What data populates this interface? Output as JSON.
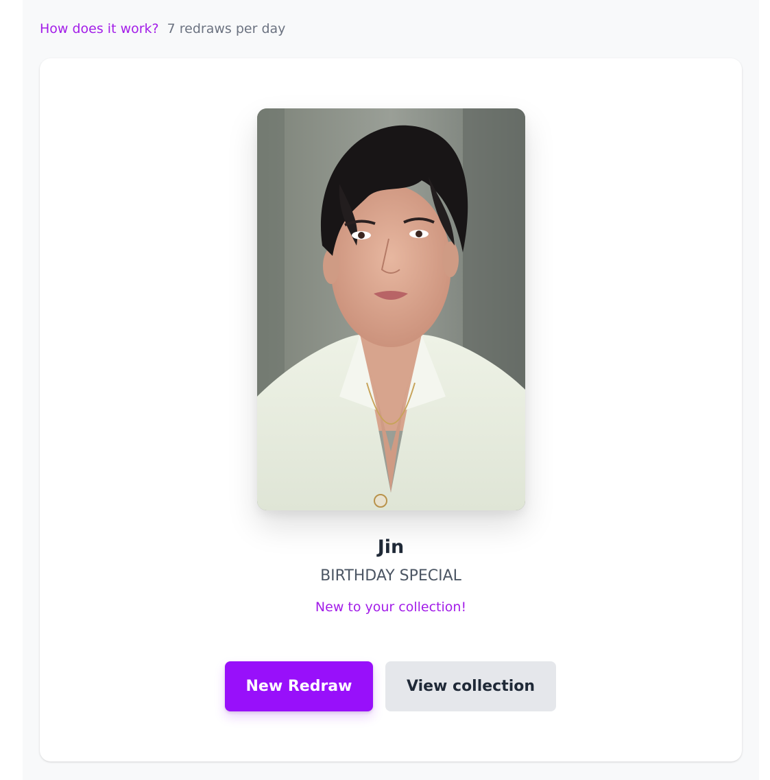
{
  "header": {
    "how_link": "How does it work?",
    "redraws_text": "7 redraws per day"
  },
  "card": {
    "member_name": "Jin",
    "set_name": "BIRTHDAY SPECIAL",
    "status_text": "New to your collection!"
  },
  "actions": {
    "new_redraw_label": "New Redraw",
    "view_collection_label": "View collection"
  },
  "colors": {
    "accent": "#9810fa",
    "link": "#a21ce8",
    "secondary_button": "#e5e7eb",
    "page_background": "#f8f9fa"
  }
}
